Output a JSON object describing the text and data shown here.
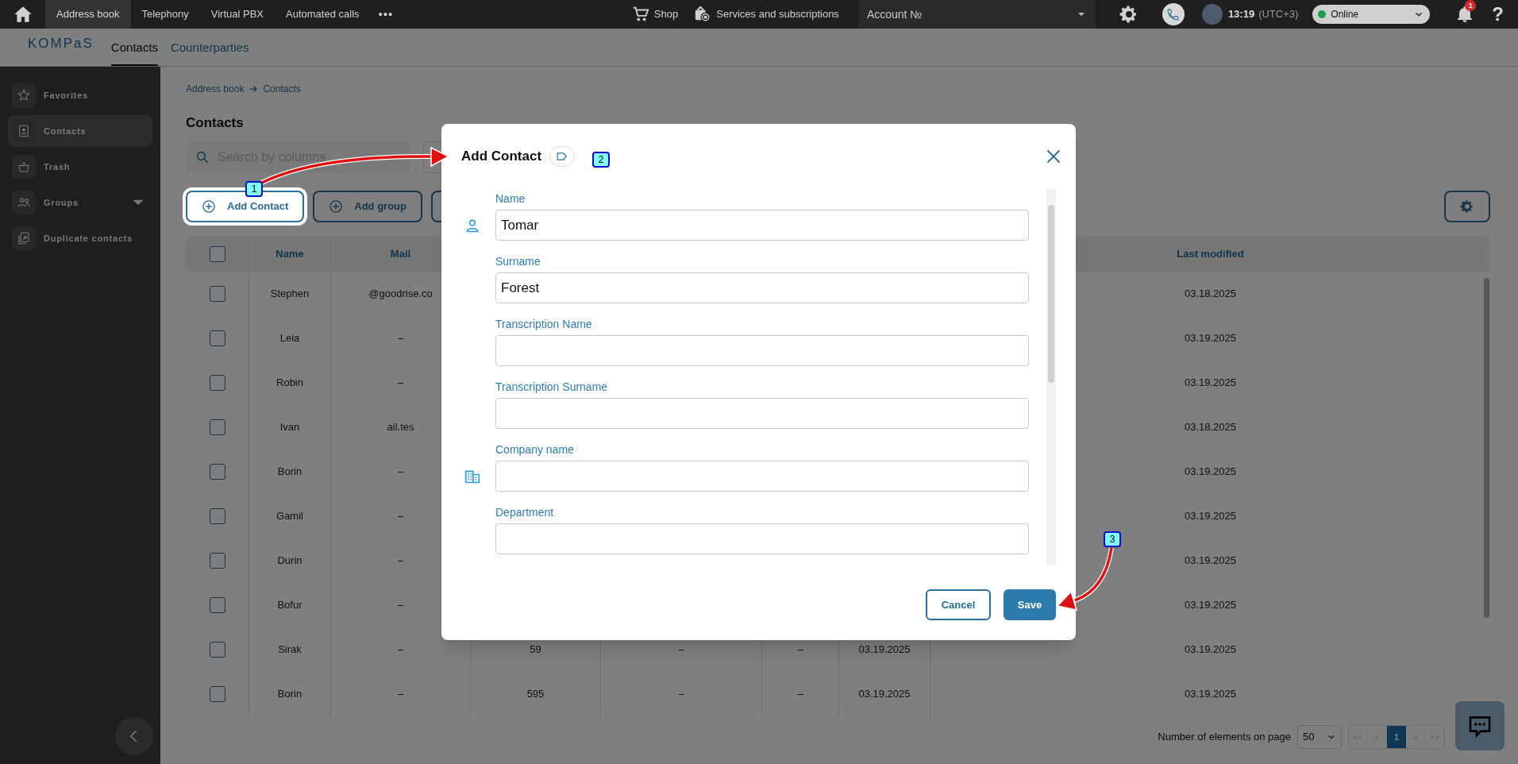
{
  "top_bar": {
    "tabs": [
      {
        "label": "Address book",
        "selected": true
      },
      {
        "label": "Telephony",
        "selected": false
      },
      {
        "label": "Virtual PBX",
        "selected": false
      },
      {
        "label": "Automated calls",
        "selected": false
      }
    ],
    "more": "•••",
    "shop": "Shop",
    "services": "Services and subscriptions",
    "account": "Account №",
    "time": "13:19",
    "timezone": "(UTC+3)",
    "status": {
      "label": "Online",
      "color": "#1e9e4a"
    },
    "notifications": "1",
    "help": "?"
  },
  "sub_nav": {
    "logo": "KOMPaS",
    "tabs": [
      {
        "label": "Contacts",
        "selected": true
      },
      {
        "label": "Counterparties",
        "selected": false
      }
    ]
  },
  "sidebar": {
    "items": [
      {
        "label": "Favorites",
        "kind": "favorites",
        "selected": false
      },
      {
        "label": "Contacts",
        "kind": "contacts",
        "selected": true
      },
      {
        "label": "Trash",
        "kind": "trash",
        "selected": false
      },
      {
        "label": "Groups",
        "kind": "groups",
        "selected": false
      },
      {
        "label": "Duplicate contacts",
        "kind": "duplicates",
        "selected": false
      }
    ]
  },
  "breadcrumb": [
    "Address book",
    "Contacts"
  ],
  "title": "Contacts",
  "search": {
    "placeholder": "Search by columns"
  },
  "buttons": [
    {
      "label": "Add Contact",
      "highlighted": true
    },
    {
      "label": "Add group",
      "highlighted": false
    }
  ],
  "table": {
    "select_all": {
      "checked": false
    },
    "columns": [
      "Name",
      "Mail",
      null,
      null,
      null,
      null,
      "Last modified"
    ],
    "rows": [
      {
        "checked": false,
        "cells": [
          "Stephen",
          "@goodrise.co",
          null,
          null,
          null,
          null,
          "03.18.2025"
        ]
      },
      {
        "checked": false,
        "cells": [
          "Leia",
          "–",
          null,
          null,
          null,
          null,
          "03.19.2025"
        ]
      },
      {
        "checked": false,
        "cells": [
          "Robin",
          "–",
          null,
          null,
          null,
          null,
          "03.19.2025"
        ]
      },
      {
        "checked": false,
        "cells": [
          "Ivan",
          "ail.tes",
          null,
          null,
          null,
          null,
          "03.18.2025"
        ]
      },
      {
        "checked": false,
        "cells": [
          "Borin",
          "–",
          null,
          null,
          null,
          null,
          "03.19.2025"
        ]
      },
      {
        "checked": false,
        "cells": [
          "Gamil",
          "–",
          null,
          null,
          null,
          null,
          "03.19.2025"
        ]
      },
      {
        "checked": false,
        "cells": [
          "Durin",
          "–",
          null,
          null,
          null,
          null,
          "03.19.2025"
        ]
      },
      {
        "checked": false,
        "cells": [
          "Bofur",
          "–",
          null,
          null,
          null,
          null,
          "03.19.2025"
        ]
      },
      {
        "checked": false,
        "cells": [
          "Sirak",
          "–",
          "59",
          "–",
          "–",
          "03.19.2025",
          "03.19.2025"
        ]
      },
      {
        "checked": false,
        "cells": [
          "Borin",
          "–",
          "595",
          "–",
          "–",
          "03.19.2025",
          "03.19.2025"
        ]
      }
    ]
  },
  "pagination": {
    "label": "Number of elements on page",
    "page_size": "50",
    "pages": [
      {
        "label": "<<",
        "selected": false,
        "disabled": true
      },
      {
        "label": "<",
        "selected": false,
        "disabled": true
      },
      {
        "label": "1",
        "selected": true,
        "disabled": false
      },
      {
        "label": ">",
        "selected": false,
        "disabled": true
      },
      {
        "label": ">>",
        "selected": false,
        "disabled": true
      }
    ]
  },
  "dialog": {
    "title": "Add Contact",
    "sections": [
      {
        "kind": "person",
        "fields": [
          {
            "label": "Name",
            "value": "Tomar"
          },
          {
            "label": "Surname",
            "value": "Forest"
          },
          {
            "label": "Transcription Name"
          },
          {
            "label": "Transcription Surname"
          }
        ]
      },
      {
        "kind": "company",
        "fields": [
          {
            "label": "Company name"
          },
          {
            "label": "Department"
          }
        ]
      }
    ],
    "buttons": [
      {
        "label": "Cancel",
        "kind": "secondary"
      },
      {
        "label": "Save",
        "kind": "primary"
      }
    ]
  },
  "annotations": [
    {
      "number": "1",
      "kind": "arrow"
    },
    {
      "number": "2",
      "kind": "badge"
    },
    {
      "number": "3",
      "kind": "arrow"
    }
  ]
}
